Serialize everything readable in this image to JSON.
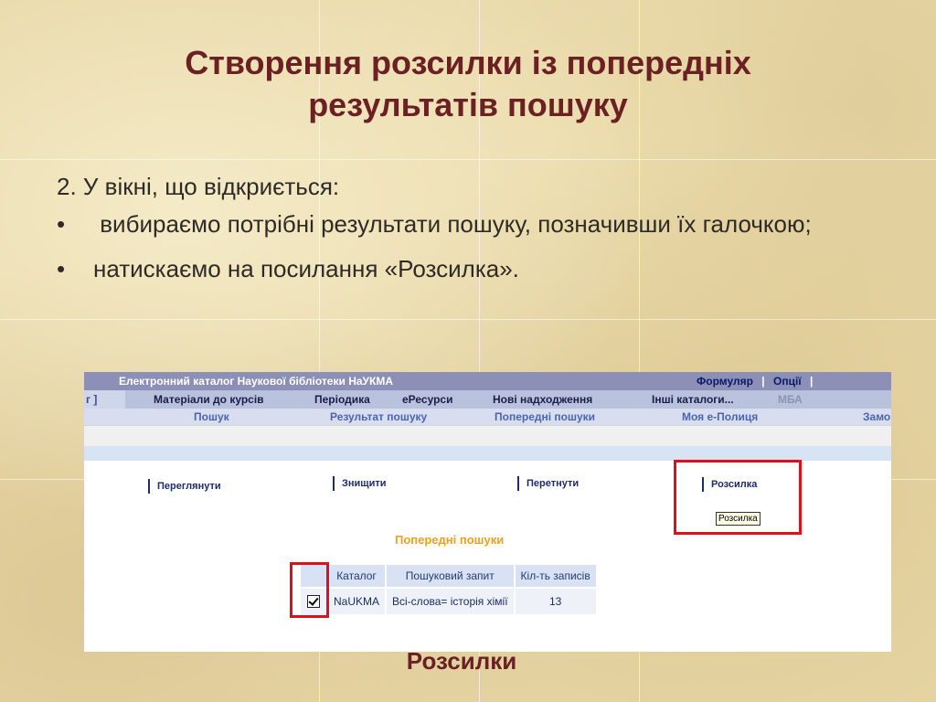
{
  "slide": {
    "title_line1": "Створення розсилки із попередніх",
    "title_line2": "результатів пошуку",
    "step": "2. У вікні, що відкриється:",
    "bullet_char": "•",
    "bullets": [
      " вибираємо потрібні результати пошуку, позначивши їх галочкою;",
      "натискаємо на посилання «Розсилка»."
    ],
    "caption": "Розсилки"
  },
  "screenshot": {
    "header_title": "Електронний каталог Наукової бібліотеки НаУКМА",
    "header_links": [
      "Формуляр",
      "Опції"
    ],
    "header_sep": "|",
    "menu_bracket": "г ]",
    "menu": [
      "Матеріали до курсів",
      "Періодика",
      "еРесурси",
      "Нові надходження",
      "Інші каталоги...",
      "МБА"
    ],
    "submenu": [
      "Пошук",
      "Результат пошуку",
      "Попередні пошуки",
      "Моя е-Полиця",
      "Замо"
    ],
    "actions": [
      "Переглянути",
      "Знищити",
      "Перетнути",
      "Розсилка"
    ],
    "tooltip": "Розсилка",
    "section_title": "Попередні пошуки",
    "table": {
      "headers": [
        "",
        "Каталог",
        "Пошуковий запит",
        "Кіл-ть записів"
      ],
      "row": {
        "checked": true,
        "catalog": "NaUKMA",
        "query": "Всі-слова= історія хімії",
        "count": "13"
      }
    }
  },
  "colors": {
    "title": "#6b2023",
    "highlight_box": "#e0101a",
    "section_title": "#f0a020",
    "header_bar": "#8c8fb6"
  }
}
